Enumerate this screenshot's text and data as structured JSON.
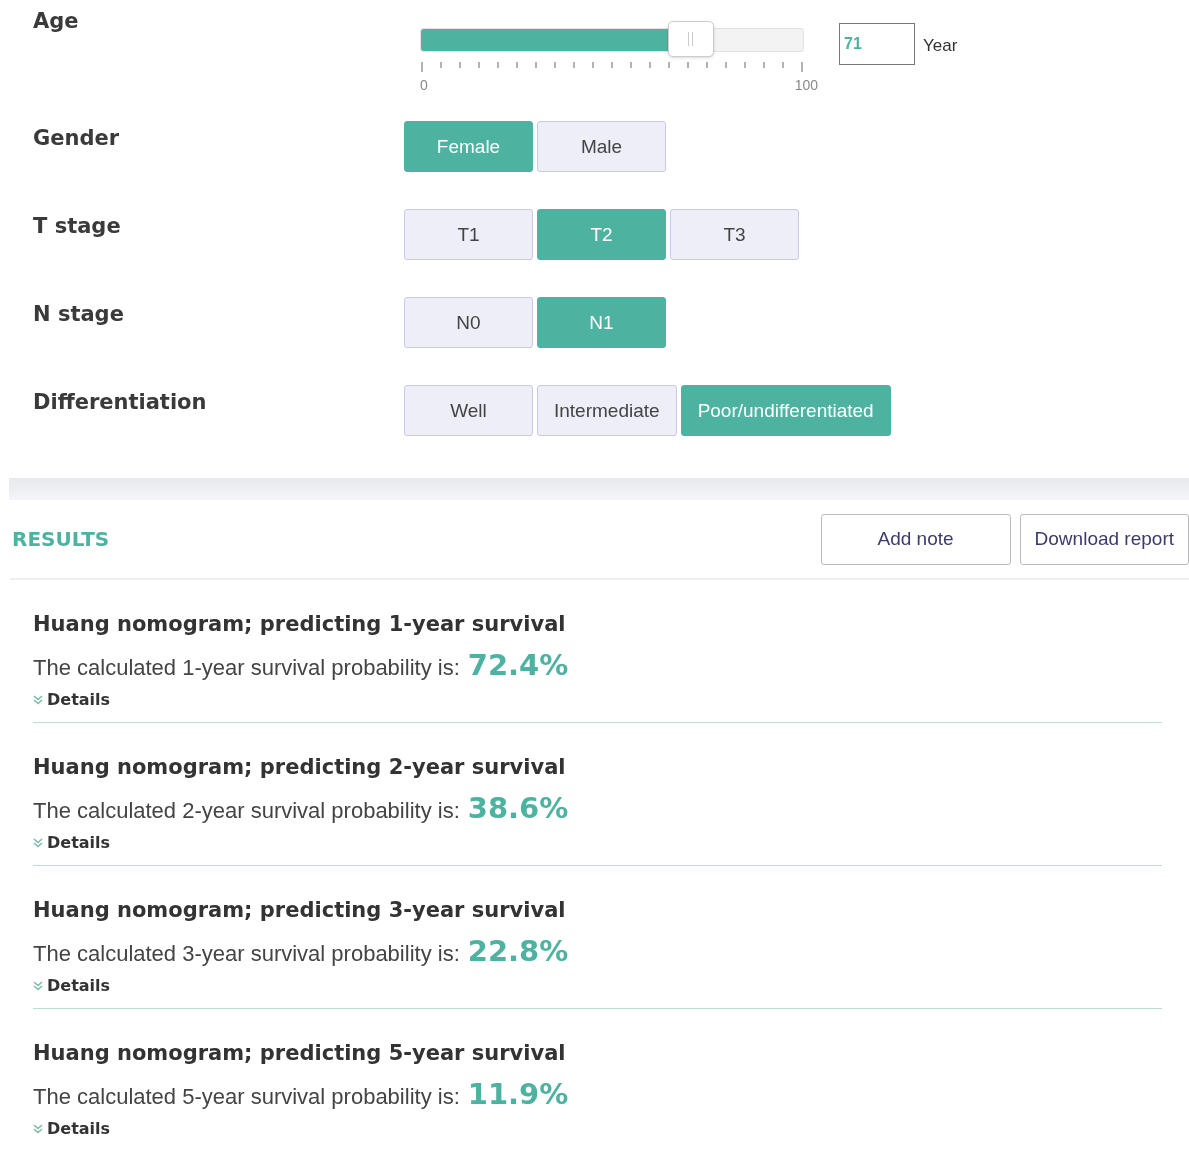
{
  "inputs": {
    "age": {
      "label": "Age",
      "level": 0.71,
      "min_label": "0",
      "max_label": "100",
      "value": "71",
      "unit": "Year"
    },
    "groups": [
      {
        "label": "Gender",
        "options": [
          {
            "label": "Female",
            "selected": true
          },
          {
            "label": "Male",
            "selected": false
          }
        ]
      },
      {
        "label": "T stage",
        "options": [
          {
            "label": "T1",
            "selected": false
          },
          {
            "label": "T2",
            "selected": true
          },
          {
            "label": "T3",
            "selected": false
          }
        ]
      },
      {
        "label": "N stage",
        "options": [
          {
            "label": "N0",
            "selected": false
          },
          {
            "label": "N1",
            "selected": true
          }
        ]
      },
      {
        "label": "Differentiation",
        "options": [
          {
            "label": "Well",
            "selected": false
          },
          {
            "label": "Intermediate",
            "selected": false
          },
          {
            "label": "Poor/undifferentiated",
            "selected": true
          }
        ]
      }
    ]
  },
  "results": {
    "heading": "RESULTS",
    "buttons": [
      "Add note",
      "Download report"
    ],
    "items": [
      {
        "title": "Huang nomogram; predicting 1-year survival",
        "text": "The calculated 1-year survival probability is:",
        "value": "72.4%",
        "details": "Details"
      },
      {
        "title": "Huang nomogram; predicting 2-year survival",
        "text": "The calculated 2-year survival probability is:",
        "value": "38.6%",
        "details": "Details"
      },
      {
        "title": "Huang nomogram; predicting 3-year survival",
        "text": "The calculated 3-year survival probability is:",
        "value": "22.8%",
        "details": "Details"
      },
      {
        "title": "Huang nomogram; predicting 5-year survival",
        "text": "The calculated 5-year survival probability is:",
        "value": "11.9%",
        "details": "Details"
      }
    ]
  }
}
